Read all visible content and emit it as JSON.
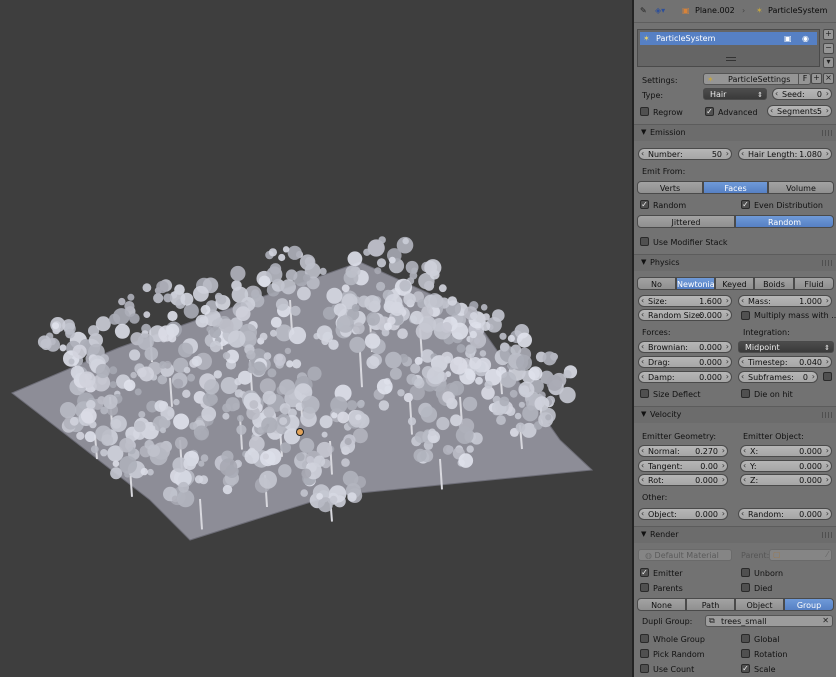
{
  "header": {
    "breadcrumb": [
      "Plane.002",
      "ParticleSystem"
    ]
  },
  "particle_list": {
    "items": [
      "ParticleSystem"
    ]
  },
  "settings": {
    "settings_label": "Settings:",
    "settings_value": "ParticleSettings",
    "fake_user": "F",
    "type_label": "Type:",
    "type_value": "Hair",
    "seed_label": "Seed:",
    "seed_value": "0",
    "regrow_label": "Regrow",
    "advanced_label": "Advanced",
    "segments_label": "Segments:",
    "segments_value": "5"
  },
  "emission": {
    "title": "Emission",
    "number_label": "Number:",
    "number_value": "50",
    "hair_length_label": "Hair Length:",
    "hair_length_value": "1.080",
    "emit_from_label": "Emit From:",
    "emit_from_options": [
      "Verts",
      "Faces",
      "Volume"
    ],
    "emit_from_selected": "Faces",
    "random_label": "Random",
    "even_distribution_label": "Even Distribution",
    "distribution_options": [
      "Jittered",
      "Random"
    ],
    "distribution_selected": "Random",
    "use_modifier_stack_label": "Use Modifier Stack"
  },
  "physics": {
    "title": "Physics",
    "types": [
      "No",
      "Newtonian",
      "Keyed",
      "Boids",
      "Fluid"
    ],
    "selected_type": "Newtonian",
    "size_label": "Size:",
    "size_value": "1.600",
    "mass_label": "Mass:",
    "mass_value": "1.000",
    "random_size_label": "Random Size:",
    "random_size_value": "0.000",
    "multiply_mass_label": "Multiply mass with ...",
    "forces_label": "Forces:",
    "integration_label": "Integration:",
    "brownian_label": "Brownian:",
    "brownian_value": "0.000",
    "integration_value": "Midpoint",
    "drag_label": "Drag:",
    "drag_value": "0.000",
    "timestep_label": "Timestep:",
    "timestep_value": "0.040",
    "damp_label": "Damp:",
    "damp_value": "0.000",
    "subframes_label": "Subframes:",
    "subframes_value": "0",
    "size_deflect_label": "Size Deflect",
    "die_on_hit_label": "Die on hit"
  },
  "velocity": {
    "title": "Velocity",
    "emitter_geometry_label": "Emitter Geometry:",
    "emitter_object_label": "Emitter Object:",
    "normal_label": "Normal:",
    "normal_value": "0.270",
    "x_label": "X:",
    "x_value": "0.000",
    "tangent_label": "Tangent:",
    "tangent_value": "0.00",
    "y_label": "Y:",
    "y_value": "0.000",
    "rot_label": "Rot:",
    "rot_value": "0.000",
    "z_label": "Z:",
    "z_value": "0.000",
    "other_label": "Other:",
    "object_label": "Object:",
    "object_value": "0.000",
    "random_label": "Random:",
    "random_value": "0.000"
  },
  "render": {
    "title": "Render",
    "material_value": "Default Material",
    "parent_label": "Parent:",
    "emitter_label": "Emitter",
    "unborn_label": "Unborn",
    "parents_label": "Parents",
    "died_label": "Died",
    "render_types": [
      "None",
      "Path",
      "Object",
      "Group"
    ],
    "render_selected": "Group",
    "dupli_group_label": "Dupli Group:",
    "dupli_group_value": "trees_small",
    "whole_group_label": "Whole Group",
    "global_label": "Global",
    "pick_random_label": "Pick Random",
    "rotation_label": "Rotation",
    "use_count_label": "Use Count",
    "scale_label": "Scale"
  },
  "colors": {
    "accent": "#5680c4",
    "panel_bg": "#727272",
    "viewport_bg": "#3e3e3e",
    "foliage": "#b9bcc9",
    "ground": "#8c8c96"
  }
}
